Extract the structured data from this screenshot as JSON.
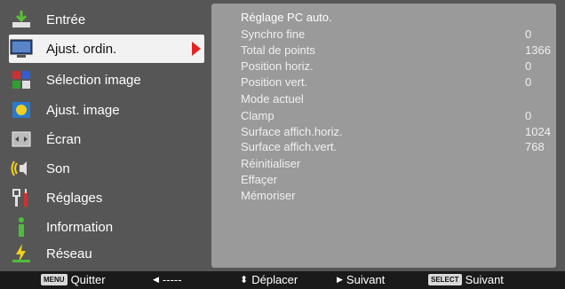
{
  "menu": {
    "items": [
      {
        "label": "Entrée",
        "icon": "input-arrow-icon"
      },
      {
        "label": "Ajust. ordin.",
        "icon": "computer-monitor-icon",
        "selected": true
      },
      {
        "label": "Sélection image",
        "icon": "image-select-icon"
      },
      {
        "label": "Ajust. image",
        "icon": "image-adjust-icon"
      },
      {
        "label": "Écran",
        "icon": "screen-icon"
      },
      {
        "label": "Son",
        "icon": "speaker-icon"
      },
      {
        "label": "Réglages",
        "icon": "settings-tools-icon"
      },
      {
        "label": "Information",
        "icon": "info-icon"
      },
      {
        "label": "Réseau",
        "icon": "network-icon"
      }
    ]
  },
  "submenu": {
    "rows": [
      {
        "label": "Réglage PC auto.",
        "value": ""
      },
      {
        "label": "Synchro fine",
        "value": "0"
      },
      {
        "label": "Total de points",
        "value": "1366"
      },
      {
        "label": "Position horiz.",
        "value": "0"
      },
      {
        "label": "Position vert.",
        "value": "0"
      },
      {
        "label": "Mode actuel",
        "value": ""
      },
      {
        "label": "Clamp",
        "value": "0"
      },
      {
        "label": "Surface affich.horiz.",
        "value": "1024"
      },
      {
        "label": "Surface affich.vert.",
        "value": "768"
      },
      {
        "label": "Réinitialiser",
        "value": ""
      },
      {
        "label": "Effaçer",
        "value": ""
      },
      {
        "label": "Mémoriser",
        "value": ""
      }
    ]
  },
  "footer": {
    "menu_key": "MENU",
    "quit": "Quitter",
    "dash": "-----",
    "move": "Déplacer",
    "next1": "Suivant",
    "select_key": "SELECT",
    "next2": "Suivant"
  },
  "colors": {
    "frame_bg": "#565656",
    "panel_bg": "#9a9a9a",
    "selected_bg": "#f2f2f2",
    "arrow": "#e8221e"
  }
}
